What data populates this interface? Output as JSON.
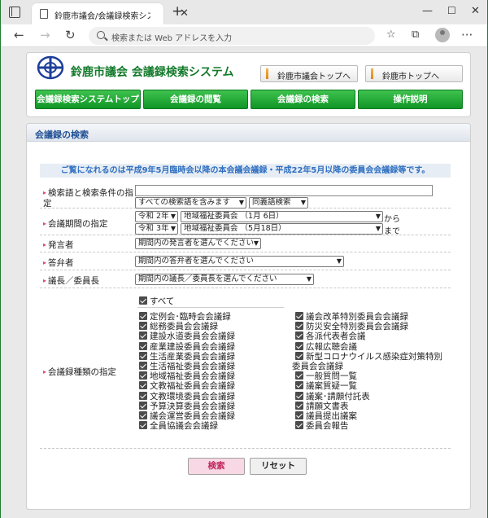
{
  "browser": {
    "tab_title": "鈴鹿市議会/会議録検索システム",
    "tab_close": "✕",
    "new_tab": "+",
    "address_placeholder": "検索または Web アドレスを入力"
  },
  "header": {
    "site_title": "鈴鹿市議会 会議録検索システム",
    "top_links": [
      "鈴鹿市議会トップへ",
      "鈴鹿市トップへ"
    ],
    "menu": [
      "会議録検索システムトップ",
      "会議録の閲覧",
      "会議録の検索",
      "操作説明"
    ]
  },
  "panel": {
    "title": "会議録の検索",
    "notice": "ご覧になれるのは平成9年5月臨時会以降の本会議会議録・平成22年5月以降の委員会会議録等です。"
  },
  "form": {
    "keyword": {
      "label_line1": "検索語と検索条件の指",
      "label_line2": "定",
      "value": "",
      "condition": "すべての検索語を含みます",
      "synonym": "同義語検索"
    },
    "period": {
      "label": "会議期間の指定",
      "from_year": "令和 2年",
      "from_meeting": "地域福祉委員会 （1月 6日）",
      "from_suffix": "から",
      "to_year": "令和 3年",
      "to_meeting": "地域福祉委員会 （5月18日）",
      "to_suffix": "まで"
    },
    "speaker": {
      "label": "発言者",
      "placeholder": "期間内の発言者を選んでください"
    },
    "answerer": {
      "label": "答弁者",
      "placeholder": "期間内の答弁者を選んでください"
    },
    "chair": {
      "label": "議長／委員長",
      "placeholder": "期間内の議長／委員長を選んでください"
    },
    "types": {
      "label": "会議録種類の指定",
      "all": "すべて",
      "left": [
        "定例会･臨時会会議録",
        "総務委員会会議録",
        "建設水道委員会会議録",
        "産業建設委員会会議録",
        "生活産業委員会会議録",
        "生活福祉委員会会議録",
        "地域福祉委員会会議録",
        "文教福祉委員会会議録",
        "文教環境委員会会議録",
        "予算決算委員会会議録",
        "議会運営委員会会議録",
        "全員協議会会議録"
      ],
      "right_a": [
        "議会改革特別委員会会議録",
        "防災安全特別委員会会議録",
        "各派代表者会議",
        "広報広聴会議"
      ],
      "right_long_1": "新型コロナウイルス感染症対策特別",
      "right_long_2": "委員会会議録",
      "right_b": [
        "一般質問一覧",
        "議案質疑一覧",
        "議案･請願付託表",
        "請願文書表",
        "議員提出議案",
        "委員会報告"
      ]
    },
    "search_button": "検索",
    "reset_button": "リセット"
  },
  "colors": {
    "brand_green": "#127a2a",
    "menu_green": "#109627",
    "title_blue": "#1f4e95",
    "notice_blue": "#2f6fc0",
    "search_pink": "#f8d8e4"
  }
}
